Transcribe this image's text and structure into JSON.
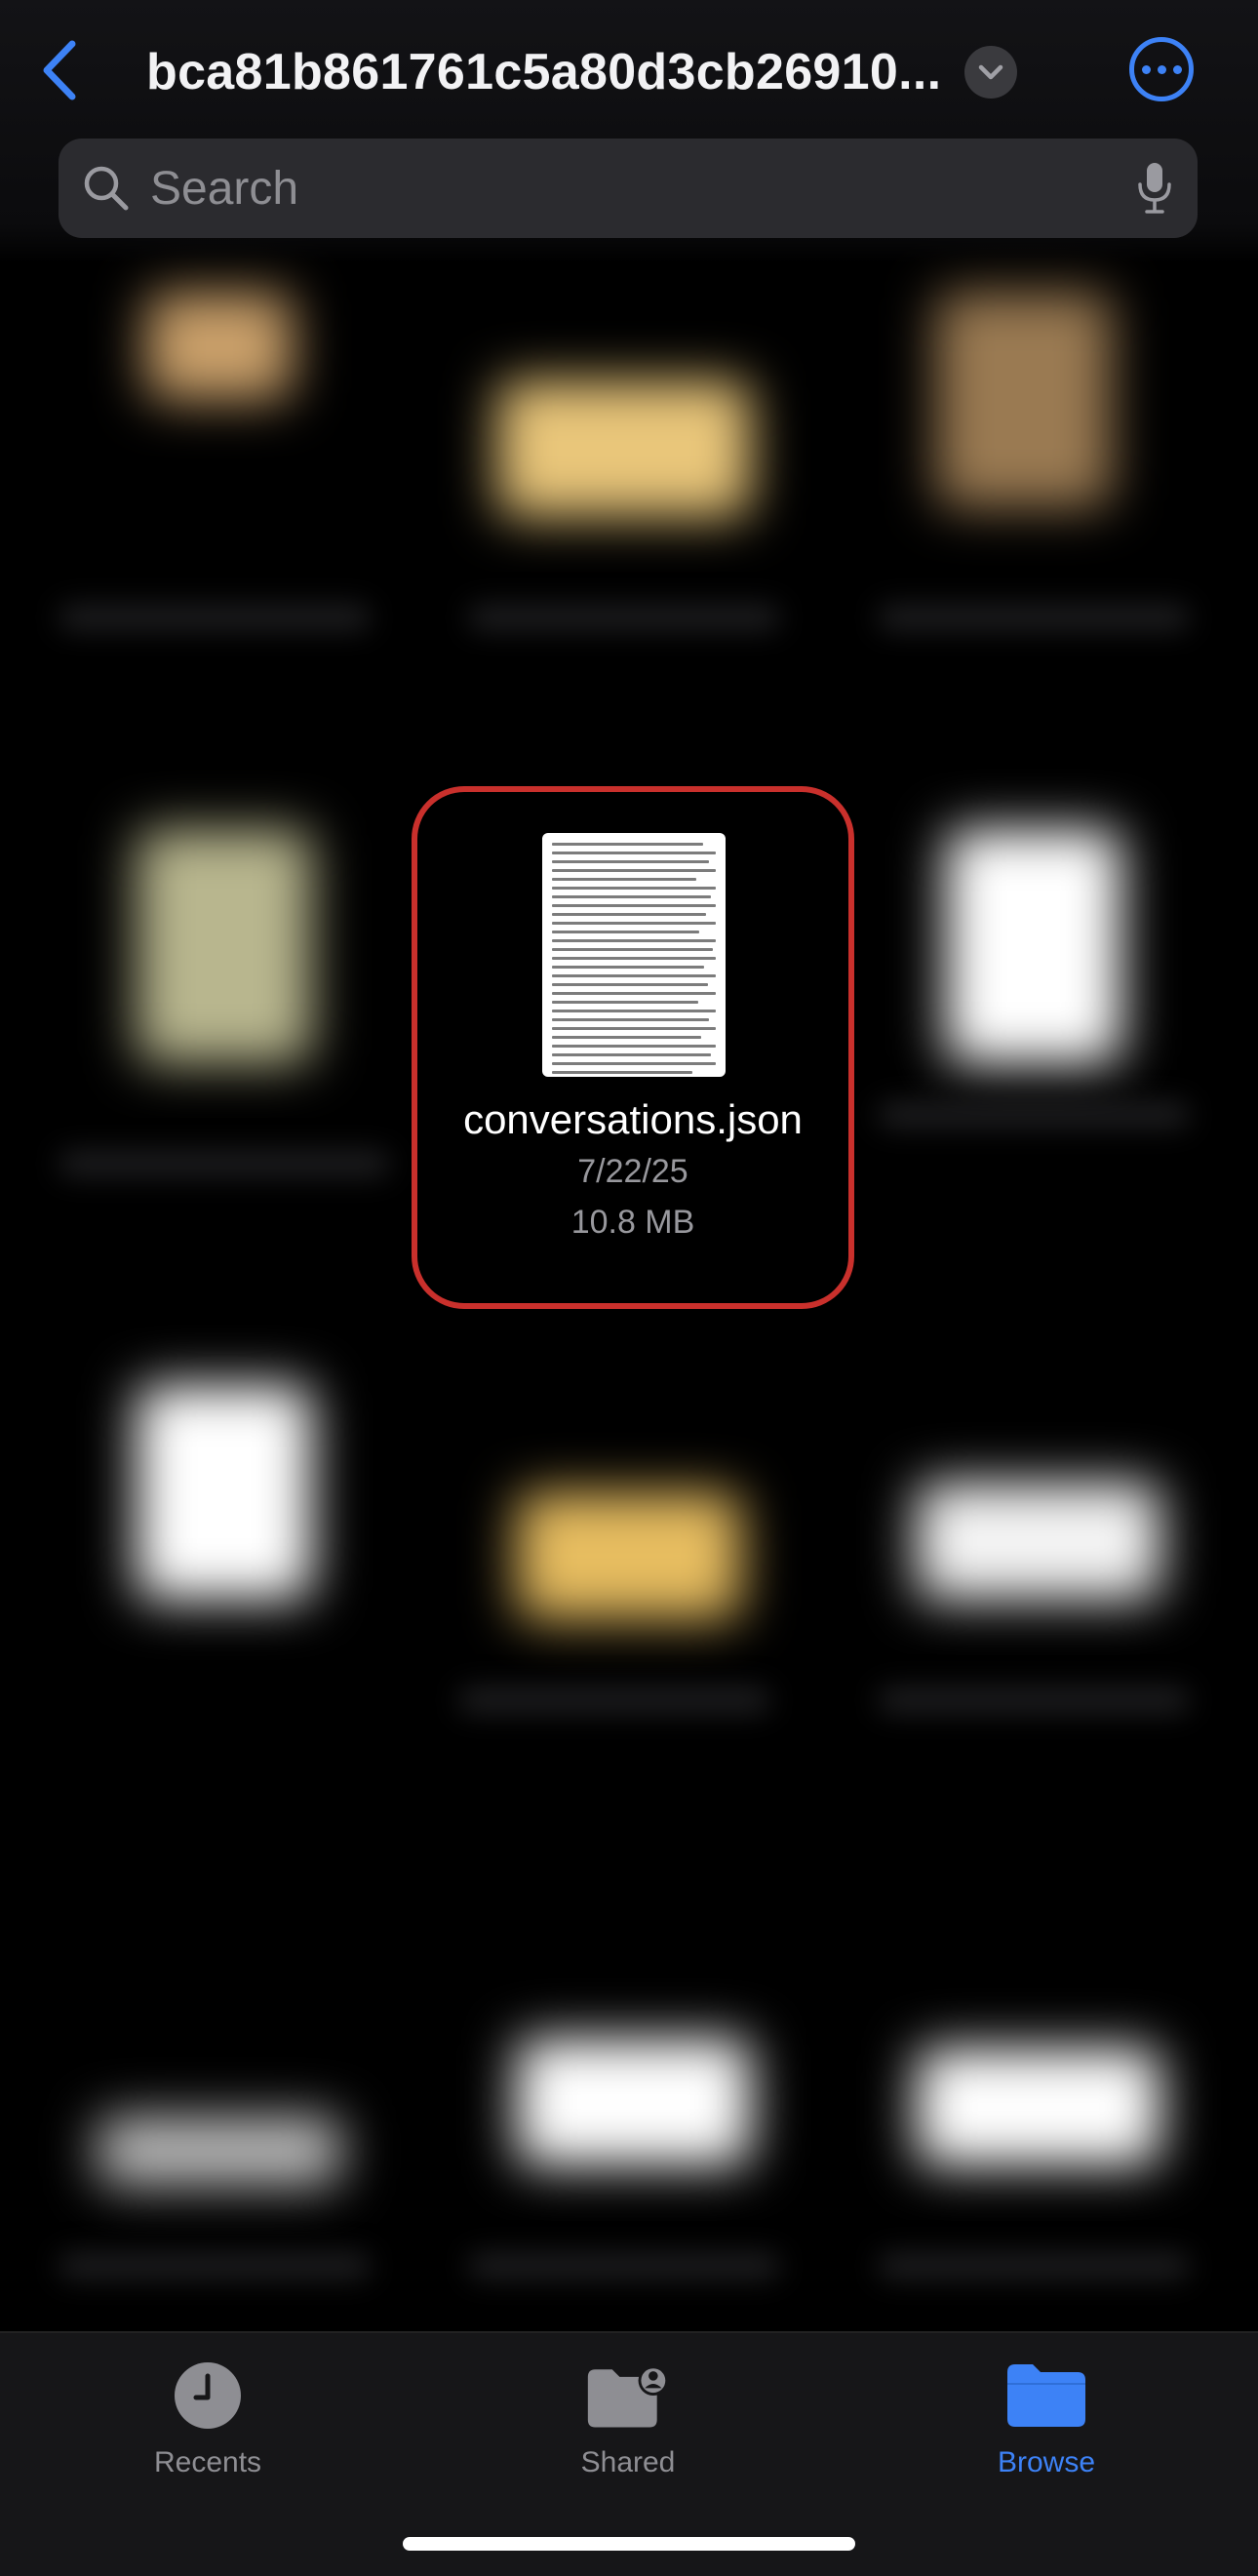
{
  "header": {
    "title": "bca81b861761c5a80d3cb26910...",
    "back_icon": "chevron-left-icon",
    "title_menu_icon": "chevron-down-icon",
    "more_icon": "ellipsis-circle-icon",
    "accent_color": "#3d82f6"
  },
  "search": {
    "placeholder": "Search",
    "value": "",
    "search_icon": "magnifying-glass-icon",
    "mic_icon": "microphone-icon"
  },
  "highlighted_file": {
    "name": "conversations.json",
    "date": "7/22/25",
    "size": "10.8 MB",
    "highlight_color": "#c9302c"
  },
  "tabbar": {
    "tabs": [
      {
        "label": "Recents",
        "icon": "clock-icon",
        "active": false
      },
      {
        "label": "Shared",
        "icon": "shared-folder-icon",
        "active": false
      },
      {
        "label": "Browse",
        "icon": "folder-icon",
        "active": true
      }
    ]
  }
}
